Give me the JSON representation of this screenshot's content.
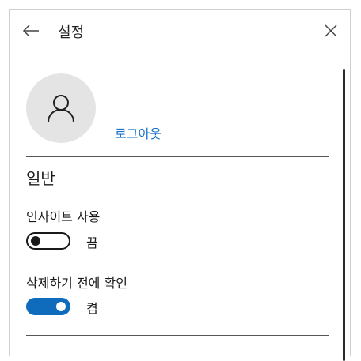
{
  "header": {
    "title": "설정"
  },
  "account": {
    "logout_label": "로그아웃"
  },
  "general": {
    "section_title": "일반",
    "settings": [
      {
        "label": "인사이트 사용",
        "state": "끔",
        "on": false
      },
      {
        "label": "삭제하기 전에 확인",
        "state": "켬",
        "on": true
      }
    ]
  },
  "icons": {
    "back": "back-arrow-icon",
    "close": "close-icon",
    "avatar": "user-icon"
  },
  "colors": {
    "accent": "#0f6cbd",
    "link": "#1a73c9"
  }
}
